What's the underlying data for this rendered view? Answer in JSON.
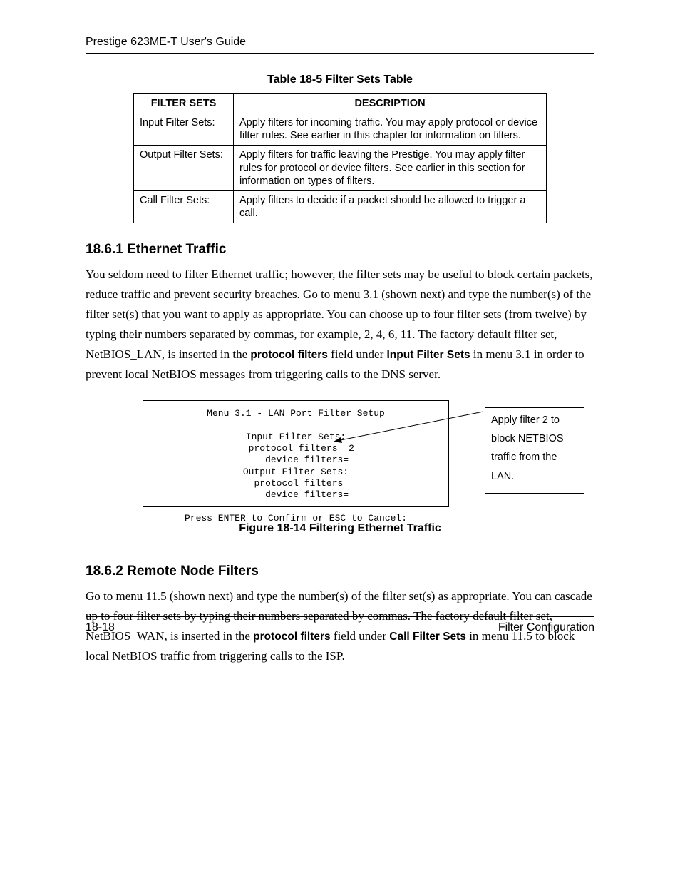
{
  "header": {
    "guide_title": "Prestige 623ME-T User's Guide"
  },
  "table": {
    "caption": "Table 18-5 Filter Sets Table",
    "headers": {
      "col1": "FILTER SETS",
      "col2": "DESCRIPTION"
    },
    "rows": [
      {
        "name": "Input Filter Sets:",
        "desc": "Apply filters for incoming traffic. You may apply protocol or device filter rules. See earlier in this chapter for information on filters."
      },
      {
        "name": "Output Filter Sets:",
        "desc": "Apply filters for traffic leaving the Prestige. You may apply filter rules for protocol or device filters. See earlier in this section for information on types of filters."
      },
      {
        "name": "Call Filter Sets:",
        "desc": "Apply filters to decide if a packet should be allowed to trigger a call."
      }
    ]
  },
  "section1": {
    "heading": "18.6.1 Ethernet Traffic",
    "p1_a": "You seldom need to filter Ethernet traffic; however, the filter sets may be useful to block certain packets, reduce traffic and prevent security breaches. Go to menu 3.1 (shown next) and type the number(s) of the filter set(s) that you want to apply as appropriate. You can choose up to four filter sets (from twelve) by typing their numbers separated by commas, for example, 2, 4, 6, 11. The factory default filter set, NetBIOS_LAN, is inserted in the ",
    "p1_b1": "protocol filters",
    "p1_c": " field under ",
    "p1_b2": "Input Filter Sets",
    "p1_d": " in menu 3.1 in order to prevent local NetBIOS messages from triggering calls to the DNS server."
  },
  "terminal": {
    "title": "Menu 3.1 - LAN Port Filter Setup",
    "lines": [
      "Input Filter Sets:",
      "  protocol filters= 2",
      "    device filters=",
      "Output Filter Sets:",
      "  protocol filters=",
      "    device filters="
    ],
    "prompt": "Press ENTER to Confirm or ESC to Cancel:"
  },
  "callout": {
    "text": "Apply filter 2 to block NETBIOS traffic from the LAN."
  },
  "figure_caption": "Figure 18-14 Filtering Ethernet Traffic",
  "section2": {
    "heading": "18.6.2 Remote Node Filters",
    "p1_a": "Go to menu 11.5 (shown next) and type the number(s) of the filter set(s) as appropriate. You can cascade up to four filter sets by typing their numbers separated by commas. The factory default filter set, NetBIOS_WAN, is inserted in the ",
    "p1_b1": "protocol filters",
    "p1_c": " field under ",
    "p1_b2": "Call Filter Sets",
    "p1_d": " in menu 11.5 to block local NetBIOS traffic from triggering calls to the ISP."
  },
  "footer": {
    "left": "18-18",
    "right": "Filter Configuration"
  }
}
